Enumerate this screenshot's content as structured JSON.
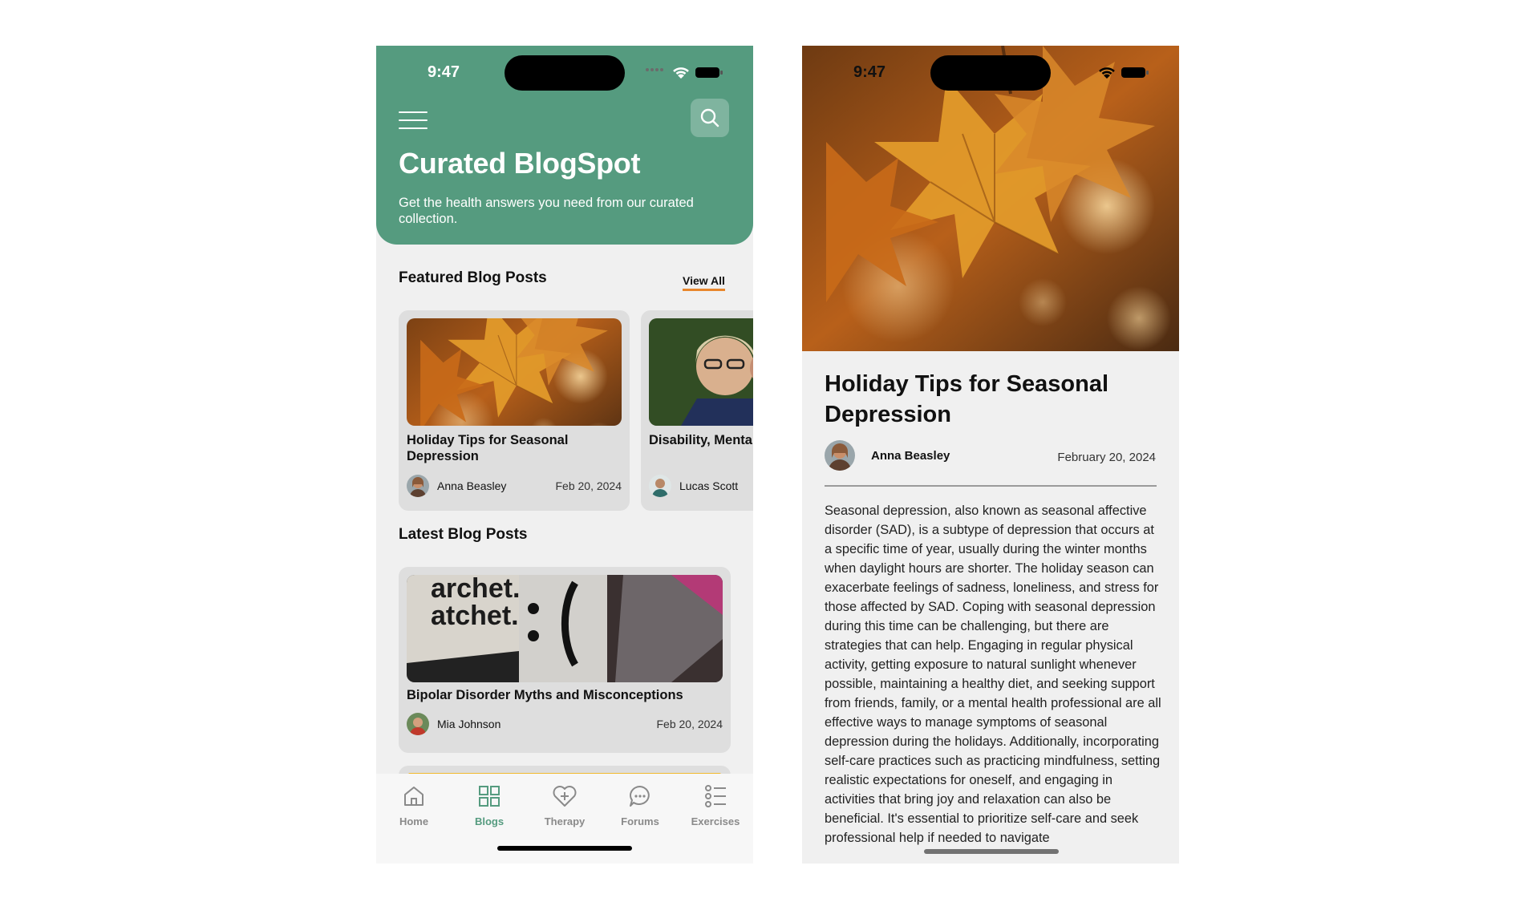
{
  "status": {
    "time": "9:47"
  },
  "blog_list": {
    "header": {
      "title": "Curated BlogSpot",
      "subtitle": "Get the health answers you need from our curated collection."
    },
    "featured": {
      "title": "Featured Blog Posts",
      "view_all": "View All",
      "cards": [
        {
          "title": "Holiday Tips for Seasonal Depression",
          "author": "Anna Beasley",
          "date": "Feb 20, 2024"
        },
        {
          "title": "Disability, Mental Ableism",
          "author": "Lucas Scott",
          "date": ""
        }
      ]
    },
    "latest": {
      "title": "Latest Blog Posts",
      "cards": [
        {
          "title": "Bipolar Disorder Myths and Misconceptions",
          "author": "Mia Johnson",
          "date": "Feb 20, 2024"
        }
      ]
    },
    "tabs": [
      {
        "label": "Home",
        "icon": "home-icon"
      },
      {
        "label": "Blogs",
        "icon": "grid-icon",
        "active": true
      },
      {
        "label": "Therapy",
        "icon": "heart-plus-icon"
      },
      {
        "label": "Forums",
        "icon": "chat-bubble-icon"
      },
      {
        "label": "Exercises",
        "icon": "list-icon"
      }
    ],
    "colors": {
      "brand_green": "#559b7f",
      "accent_orange": "#e8862c"
    }
  },
  "article": {
    "title": "Holiday Tips for Seasonal Depression",
    "author": "Anna Beasley",
    "date": "February 20, 2024",
    "body": "Seasonal depression, also known as seasonal affective disorder (SAD), is a subtype of depression that occurs at a specific time of year, usually during the winter months when daylight hours are shorter. The holiday season can exacerbate feelings of sadness, loneliness, and stress for those affected by SAD. Coping with seasonal depression during this time can be challenging, but there are strategies that can help. Engaging in regular physical activity, getting exposure to natural sunlight whenever possible, maintaining a healthy diet, and seeking support from friends, family, or a mental health professional are all effective ways to manage symptoms of seasonal depression during the holidays. Additionally, incorporating self-care practices such as practicing mindfulness, setting realistic expectations for oneself, and engaging in activities that bring joy and relaxation can also be beneficial. It's essential to prioritize self-care and seek professional help if needed to navigate"
  }
}
